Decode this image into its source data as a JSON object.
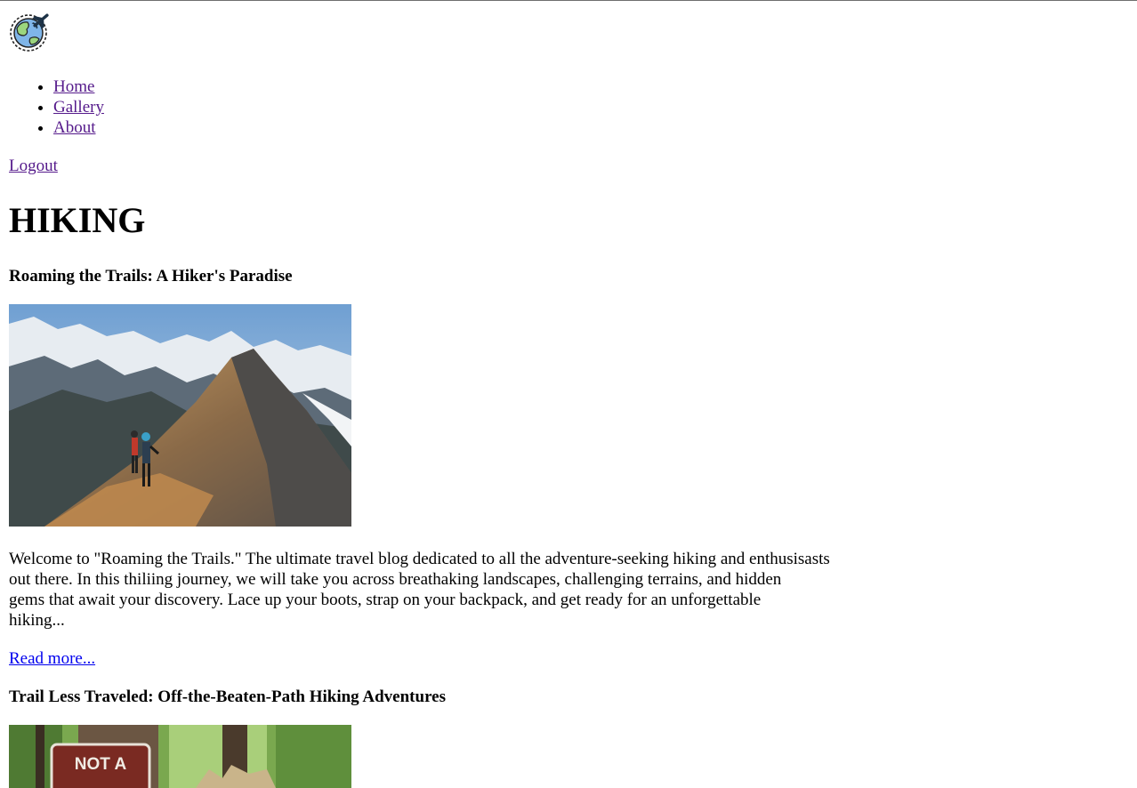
{
  "header": {
    "logo_icon": "globe-with-airplane-icon"
  },
  "nav": {
    "items": [
      {
        "label": "Home"
      },
      {
        "label": "Gallery"
      },
      {
        "label": "About"
      }
    ]
  },
  "account": {
    "logout_label": "Logout"
  },
  "page": {
    "title": "HIKING"
  },
  "posts": [
    {
      "title": "Roaming the Trails: A Hiker's Paradise",
      "excerpt_lines": [
        "Welcome to \"Roaming the Trails.\" The ultimate travel blog dedicated to all the adventure-seeking hiking and enthusisasts",
        "out there. In this thiliing journey, we will take you across breathaking landscapes, challenging terrains, and hidden",
        "gems that await your discovery. Lace up your boots, strap on your backpack, and get ready for an unforgettable",
        "hiking..."
      ],
      "read_more_label": "Read more..."
    },
    {
      "title": "Trail Less Traveled: Off-the-Beaten-Path Hiking Adventures",
      "sign_text": "NOT A"
    }
  ],
  "colors": {
    "link_visited": "#551a8b",
    "link_unvisited": "#0000ee",
    "text": "#000000",
    "background": "#ffffff"
  }
}
